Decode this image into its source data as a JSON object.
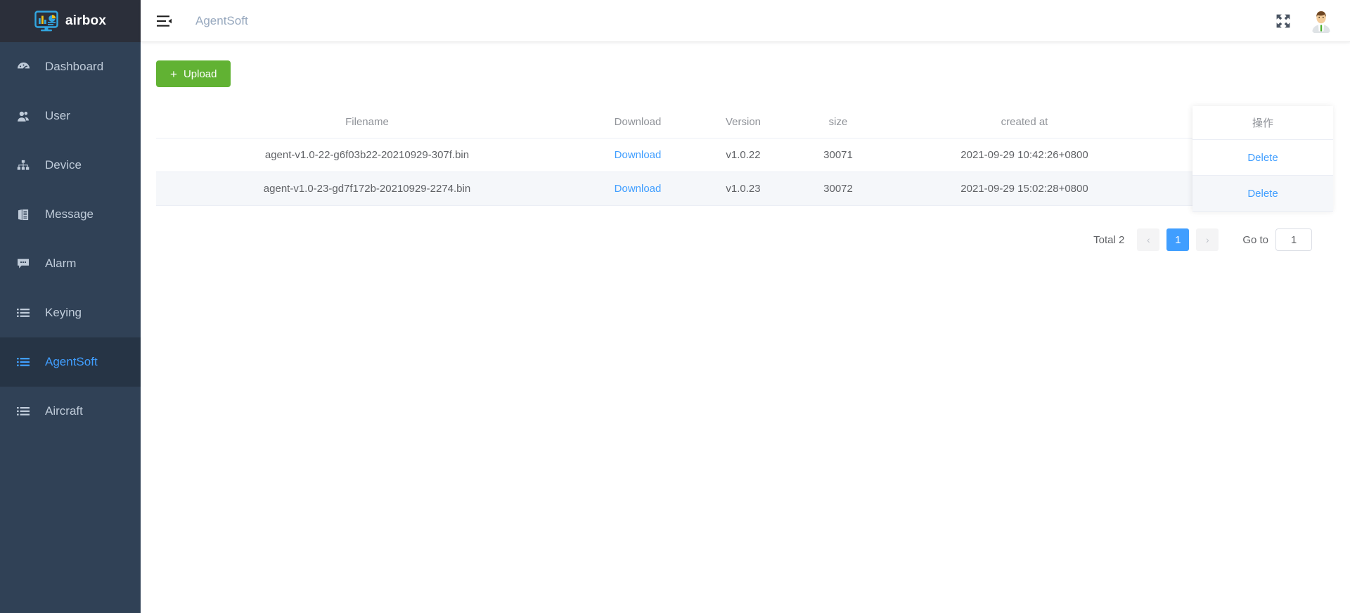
{
  "brand": {
    "name": "airbox",
    "logo_icon": "monitor-chart-icon"
  },
  "sidebar": {
    "items": [
      {
        "label": "Dashboard",
        "icon": "gauge-icon",
        "active": false
      },
      {
        "label": "User",
        "icon": "user-icon",
        "active": false
      },
      {
        "label": "Device",
        "icon": "sitemap-icon",
        "active": false
      },
      {
        "label": "Message",
        "icon": "book-icon",
        "active": false
      },
      {
        "label": "Alarm",
        "icon": "comment-icon",
        "active": false
      },
      {
        "label": "Keying",
        "icon": "list-icon",
        "active": false
      },
      {
        "label": "AgentSoft",
        "icon": "list-icon",
        "active": true
      },
      {
        "label": "Aircraft",
        "icon": "list-icon",
        "active": false
      }
    ]
  },
  "topbar": {
    "menu_icon": "hamburger-collapse-icon",
    "breadcrumb": "AgentSoft",
    "fullscreen_icon": "fullscreen-expand-icon",
    "avatar_icon": "user-avatar"
  },
  "toolbar": {
    "upload_label": "Upload",
    "upload_plus": "+"
  },
  "table": {
    "columns": [
      "Filename",
      "Download",
      "Version",
      "size",
      "created at"
    ],
    "action_column": "操作",
    "rows": [
      {
        "filename": "agent-v1.0-22-g6f03b22-20210929-307f.bin",
        "download": "Download",
        "version": "v1.0.22",
        "size": "30071",
        "created_at": "2021-09-29 10:42:26+0800",
        "action": "Delete",
        "hovered": false
      },
      {
        "filename": "agent-v1.0-23-gd7f172b-20210929-2274.bin",
        "download": "Download",
        "version": "v1.0.23",
        "size": "30072",
        "created_at": "2021-09-29 15:02:28+0800",
        "action": "Delete",
        "hovered": true
      }
    ]
  },
  "pagination": {
    "total_label": "Total 2",
    "prev": "‹",
    "next": "›",
    "pages": [
      "1"
    ],
    "current_page": "1",
    "goto_label": "Go to",
    "goto_value": "1"
  },
  "colors": {
    "sidebar_bg": "#304156",
    "sidebar_logo_bg": "#2b2f3a",
    "sidebar_active_bg": "#263445",
    "accent_blue": "#409eff",
    "upload_green": "#61b233",
    "muted_text": "#909399"
  }
}
